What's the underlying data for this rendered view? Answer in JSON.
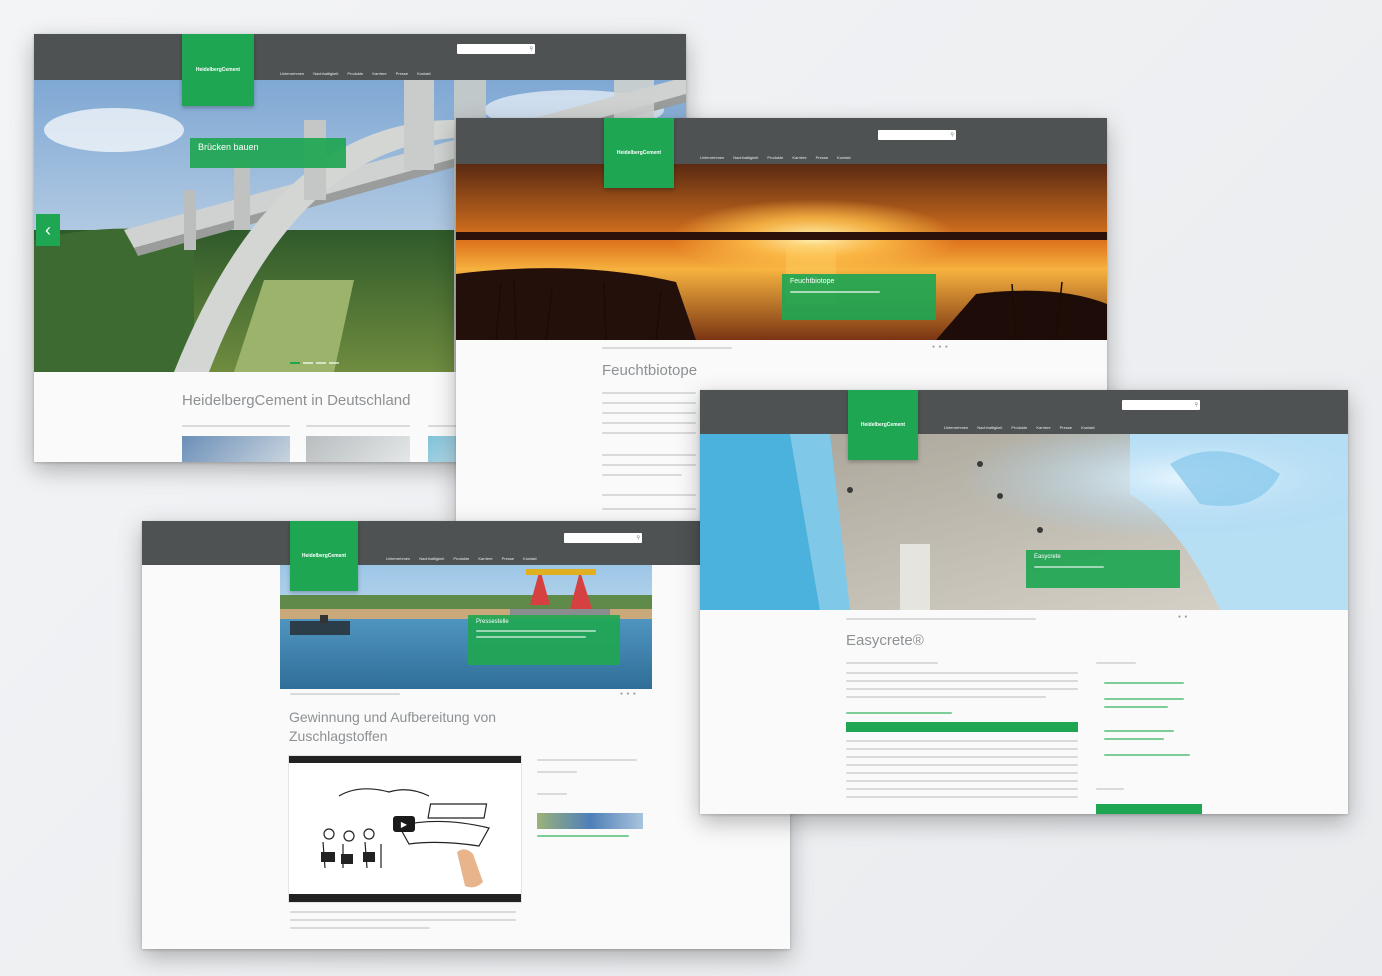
{
  "colors": {
    "brand_green": "#1fa653",
    "header_gray": "#4f5253",
    "background": "#eef0f2"
  },
  "brand": {
    "logo_label": "HeidelbergCement"
  },
  "header": {
    "nav": [
      "Unternehmen",
      "Nachhaltigkeit",
      "Produkte",
      "Karriere",
      "Presse",
      "Kontakt"
    ]
  },
  "screens": {
    "bridge": {
      "caption": "Brücken bauen",
      "title": "HeidelbergCement in Deutschland"
    },
    "wetland": {
      "caption": "Feuchtbiotope",
      "title": "Feuchtbiotope"
    },
    "interior": {
      "caption": "Easycrete",
      "title": "Easycrete®"
    },
    "aggregates": {
      "caption": "Pressestelle",
      "title_line1": "Gewinnung und Aufbereitung von",
      "title_line2": "Zuschlagstoffen"
    }
  },
  "icons": {
    "prev": "chevron-left-icon",
    "play": "play-icon",
    "search": "search-icon"
  }
}
